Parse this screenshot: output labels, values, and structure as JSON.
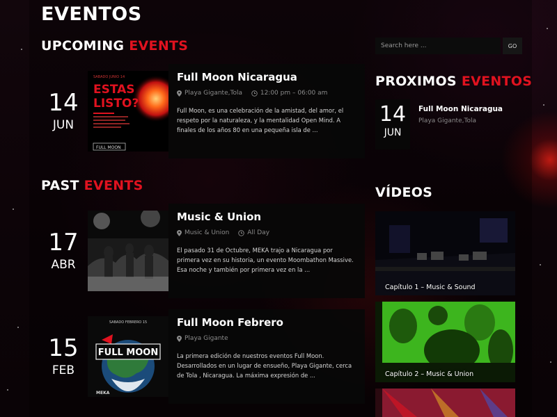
{
  "page": {
    "title": "EVENTOS"
  },
  "upcoming": {
    "heading_main": "UPCOMING",
    "heading_accent": "EVENTS",
    "events": [
      {
        "day": "14",
        "month": "JUN",
        "name": "Full Moon Nicaragua",
        "location": "Playa Gigante,Tola",
        "time": "12:00 pm – 06:00 am",
        "description": "Full Moon, es una celebración de la amistad, del amor, el respeto por la naturaleza, y la mentalidad Open Mind. A finales de los años 80 en una pequeña isla de ...",
        "poster": {
          "line1": "ESTAS",
          "line2": "LISTO?",
          "small": "SABADO JUNIO 14",
          "brand": "FULL MOON"
        }
      }
    ]
  },
  "past": {
    "heading_main": "PAST",
    "heading_accent": "EVENTS",
    "events": [
      {
        "day": "17",
        "month": "ABR",
        "name": "Music & Union",
        "location": "Music & Union",
        "time": "All Day",
        "description": "El pasado 31 de Octubre, MEKA trajo a Nicaragua por primera vez en su historia, un evento Moombathon Massive. Esa noche y también por primera vez en la ..."
      },
      {
        "day": "15",
        "month": "FEB",
        "name": "Full Moon Febrero",
        "location": "Playa Gigante",
        "description": "La primera edición de nuestros eventos Full Moon. Desarrollados en un lugar de ensueño, Playa Gigante, cerca de Tola , Nicaragua. La máxima expresión de ...",
        "poster": {
          "top": "SABADO FEBRERO 15",
          "brand": "FULL MOON",
          "sponsor": "MEKA"
        }
      }
    ]
  },
  "sidebar": {
    "search": {
      "placeholder": "Search here ...",
      "value": "",
      "button": "GO"
    },
    "proximos": {
      "heading_main": "PROXIMOS",
      "heading_accent": "EVENTOS"
    },
    "next_event": {
      "day": "14",
      "month": "JUN",
      "name": "Full Moon Nicaragua",
      "location": "Playa Gigante,Tola"
    },
    "videos": {
      "heading": "VÍDEOS",
      "items": [
        {
          "caption": "Capítulo 1 – Music & Sound"
        },
        {
          "caption": "Capítulo 2 – Music & Union"
        }
      ]
    }
  },
  "colors": {
    "accent": "#e0121f",
    "panel": "#080808",
    "muted": "#8b8b8b"
  }
}
